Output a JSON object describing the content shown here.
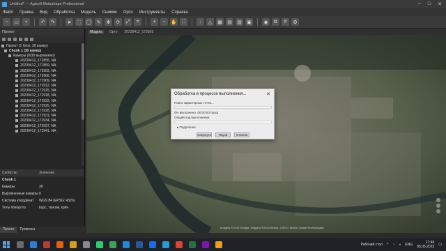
{
  "window": {
    "title": "Untitled* — Agisoft Metashape Professional"
  },
  "menu": [
    "Файл",
    "Правка",
    "Вид",
    "Обработка",
    "Модель",
    "Снимок",
    "Орто",
    "Инструменты",
    "Справка"
  ],
  "toolbar": {
    "icons": [
      "new-icon",
      "open-icon",
      "save-icon",
      "undo-icon",
      "redo-icon",
      "pointer-icon",
      "rect-select-icon",
      "circle-select-icon",
      "free-select-icon",
      "move-icon",
      "rotate-icon",
      "resize-icon",
      "crop-icon",
      "zoom-in-icon",
      "zoom-out-icon",
      "pan-icon",
      "fit-icon",
      "dense-cloud-icon",
      "mesh-icon",
      "texture-icon",
      "tiled-icon",
      "dem-icon",
      "ortho-icon",
      "camera-icon",
      "grid-icon",
      "settings-icon",
      "display-icon"
    ]
  },
  "project_panel": {
    "title": "Проект",
    "root": "Проект (1 блок, 30 камер)",
    "chunk": "Chunk 1 (30 камер)",
    "cameras_group": "Камеры (0/30 выровнено)",
    "cameras": [
      "20230412_172855, NA",
      "20230412_172859, NA",
      "20230412_172903, NA",
      "20230412_172906, NA",
      "20230412_172909, NA",
      "20230412_172912, NA",
      "20230412_172915, NA",
      "20230412_172918, NA",
      "20230412_172922, NA",
      "20230412_172925, NA",
      "20230412_172928, NA",
      "20230412_172931, NA",
      "20230412_172934, NA",
      "20230412_172937, NA",
      "20230412_172941, NA"
    ]
  },
  "properties": {
    "col_property": "Свойство",
    "col_value": "Значение",
    "chunk_name": "Chunk 1",
    "rows": [
      {
        "name": "Камеры",
        "value": "30"
      },
      {
        "name": "Выровненные камеры",
        "value": "0"
      },
      {
        "name": "Система координат",
        "value": "WGS 84 (EPSG::4326)"
      },
      {
        "name": "Углы поворота",
        "value": "Курс, тангаж, крен"
      }
    ]
  },
  "left_tabs": [
    "Проект",
    "Привязка"
  ],
  "view_tabs": [
    "Модель",
    "Орто",
    "20230412_172855"
  ],
  "dialog": {
    "title": "Обработка в процессе выполнения...",
    "stage": "Поиск характерных точек...",
    "progress_text": "0% выполнено, 00:00:00 прош",
    "total_label": "Общий ход выполнения:",
    "details": "Подробнее",
    "buttons": {
      "minimize": "Свернуть",
      "pause": "Пауза",
      "cancel": "Отмена"
    },
    "stage_progress": 0,
    "total_progress": 0
  },
  "viewport": {
    "copyright": "Imagery ©2023 Google, Imagery ©2023 Airbus, CNES / Airbus, Maxar Technologies"
  },
  "taskbar": {
    "tray_text": "Рабочий стол",
    "lang": "ENG",
    "time": "17:48",
    "date": "05.05.2023",
    "app_icons": [
      {
        "name": "search-icon",
        "color": "#6a6a6a"
      },
      {
        "name": "photos-icon",
        "color": "#2d7dd2"
      },
      {
        "name": "app-red-icon",
        "color": "#c0392b"
      },
      {
        "name": "firefox-icon",
        "color": "#e66000"
      },
      {
        "name": "metashape-icon",
        "color": "#d4a017"
      },
      {
        "name": "pinwheel-icon",
        "color": "#888888"
      },
      {
        "name": "browser-icon",
        "color": "#2ecc71"
      },
      {
        "name": "chrome-icon",
        "color": "#3aa757"
      },
      {
        "name": "edge-icon",
        "color": "#1e88e5"
      },
      {
        "name": "word-icon",
        "color": "#2b579a"
      },
      {
        "name": "app-blue-icon",
        "color": "#0d6efd"
      },
      {
        "name": "telegram-icon",
        "color": "#229ed9"
      },
      {
        "name": "chrome2-icon",
        "color": "#db4437"
      },
      {
        "name": "excel-icon",
        "color": "#217346"
      },
      {
        "name": "onenote-icon",
        "color": "#7719aa"
      },
      {
        "name": "app-orange-icon",
        "color": "#f39c12"
      }
    ]
  }
}
